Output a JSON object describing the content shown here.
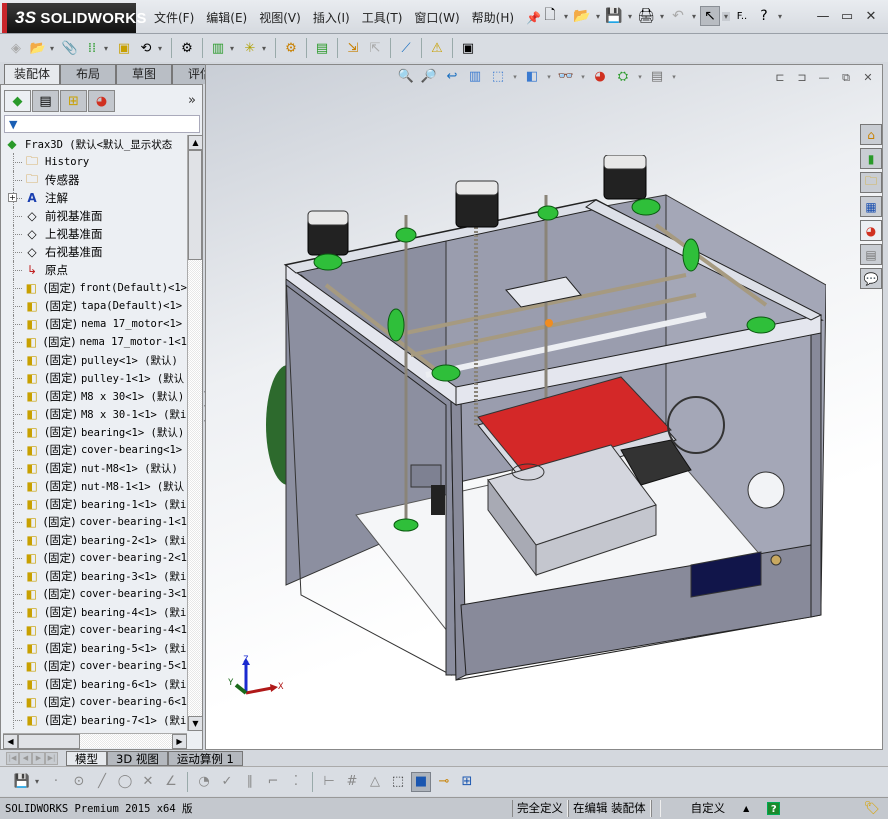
{
  "app": {
    "brand": "SOLIDWORKS",
    "brand_prefix": "3S"
  },
  "menu": {
    "items": [
      "文件(F)",
      "编辑(E)",
      "视图(V)",
      "插入(I)",
      "工具(T)",
      "窗口(W)",
      "帮助(H)"
    ]
  },
  "quick_access": {
    "pin_icon": "pushpin-icon",
    "buttons": [
      {
        "icon": "new-document-icon",
        "glyph": "🗋"
      },
      {
        "icon": "open-folder-icon",
        "glyph": "📂"
      },
      {
        "icon": "save-icon",
        "glyph": "💾"
      },
      {
        "icon": "print-icon",
        "glyph": "🖨"
      },
      {
        "icon": "undo-icon",
        "glyph": "↶"
      },
      {
        "icon": "select-pointer-icon",
        "glyph": "↖"
      }
    ],
    "fit_label": "F..",
    "help_glyph": "?"
  },
  "window_controls": {
    "minimize": "—",
    "restore": "▭",
    "close": "✕"
  },
  "command_tabs": [
    {
      "label": "装配体",
      "active": true
    },
    {
      "label": "布局",
      "active": false
    },
    {
      "label": "草图",
      "active": false
    },
    {
      "label": "评估",
      "active": false
    }
  ],
  "feature_manager": {
    "expand_glyph": "»",
    "filter_glyph": "▼",
    "root": "Frax3D  (默认<默认_显示状态",
    "items": [
      {
        "label": "History",
        "icon": "history-folder-icon",
        "mono": true
      },
      {
        "label": "传感器",
        "icon": "sensor-folder-icon",
        "mono": false
      },
      {
        "label": "注解",
        "icon": "annotation-folder-icon",
        "mono": false,
        "expandable": true
      },
      {
        "label": "前视基准面",
        "icon": "plane-icon",
        "mono": false
      },
      {
        "label": "上视基准面",
        "icon": "plane-icon",
        "mono": false
      },
      {
        "label": "右视基准面",
        "icon": "plane-icon",
        "mono": false
      },
      {
        "label": "原点",
        "icon": "origin-icon",
        "mono": false
      }
    ],
    "fixed_prefix": "(固定)",
    "components": [
      "front(Default)<1>",
      "tapa(Default)<1>",
      "nema 17_motor<1>",
      "nema 17_motor-1<1",
      "pulley<1> (默认)",
      "pulley-1<1> (默认",
      "M8 x 30<1> (默认)",
      "M8 x 30-1<1> (默i",
      "bearing<1> (默认)",
      "cover-bearing<1>",
      "nut-M8<1> (默认)",
      "nut-M8-1<1> (默认",
      "bearing-1<1> (默i",
      "cover-bearing-1<1",
      "bearing-2<1> (默i",
      "cover-bearing-2<1",
      "bearing-3<1> (默i",
      "cover-bearing-3<1",
      "bearing-4<1> (默i",
      "cover-bearing-4<1",
      "bearing-5<1> (默i",
      "cover-bearing-5<1",
      "bearing-6<1> (默i",
      "cover-bearing-6<1",
      "bearing-7<1> (默i"
    ]
  },
  "heads_up_toolbar": [
    {
      "icon": "zoom-to-fit-icon",
      "glyph": "🔍"
    },
    {
      "icon": "zoom-to-area-icon",
      "glyph": "🔎"
    },
    {
      "icon": "previous-view-icon",
      "glyph": "↩"
    },
    {
      "icon": "section-view-icon",
      "glyph": "▥"
    },
    {
      "icon": "view-orientation-icon",
      "glyph": "⬚"
    },
    {
      "icon": "display-style-icon",
      "glyph": "◧"
    },
    {
      "icon": "hide-show-items-icon",
      "glyph": "👓"
    },
    {
      "icon": "edit-appearance-icon",
      "glyph": "◕"
    },
    {
      "icon": "apply-scene-icon",
      "glyph": "⛭"
    },
    {
      "icon": "view-settings-icon",
      "glyph": "▤"
    }
  ],
  "viewport_controls": [
    "⊏",
    "⊐",
    "—",
    "⧉",
    "✕"
  ],
  "task_pane": [
    {
      "icon": "solidworks-resources-icon",
      "glyph": "⌂"
    },
    {
      "icon": "design-library-icon",
      "glyph": "▮"
    },
    {
      "icon": "file-explorer-icon",
      "glyph": "🗀"
    },
    {
      "icon": "view-palette-icon",
      "glyph": "▦"
    },
    {
      "icon": "appearances-icon",
      "glyph": "◕"
    },
    {
      "icon": "custom-properties-icon",
      "glyph": "▤"
    },
    {
      "icon": "forum-icon",
      "glyph": "💬"
    }
  ],
  "triad": {
    "x": "X",
    "y": "Y",
    "z": "Z"
  },
  "bottom_tabs": [
    {
      "label": "模型",
      "active": true
    },
    {
      "label": "3D 视图",
      "active": false
    },
    {
      "label": "运动算例 1",
      "active": false
    }
  ],
  "status": {
    "app_version": "SOLIDWORKS Premium 2015 x64 版",
    "definition": "完全定义",
    "editing": "在编辑 装配体",
    "units": "自定义",
    "units_arrow": "▲",
    "help": "?"
  }
}
